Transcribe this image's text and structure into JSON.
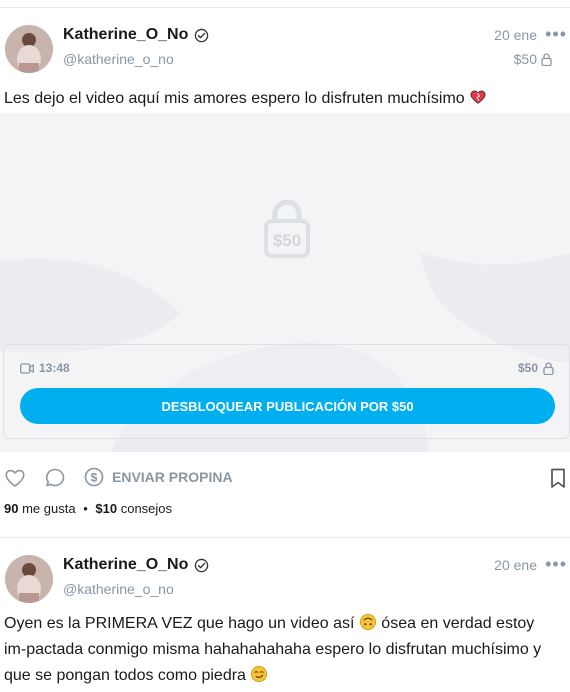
{
  "posts": [
    {
      "author": {
        "name": "Katherine_O_No",
        "handle": "@katherine_o_no"
      },
      "date": "20 ene",
      "price": "$50",
      "text": "Les dejo el video aquí mis amores espero lo disfruten muchísimo",
      "media": {
        "lock_price": "$50",
        "duration": "13:48",
        "panel_price": "$50",
        "unlock_label": "DESBLOQUEAR PUBLICACIÓN POR $50"
      },
      "tip_label": "ENVIAR PROPINA",
      "likes_count": "90",
      "likes_label": "me gusta",
      "tips_amount": "$10",
      "tips_label": "consejos"
    },
    {
      "author": {
        "name": "Katherine_O_No",
        "handle": "@katherine_o_no"
      },
      "date": "20 ene",
      "text_parts": [
        "Oyen es la PRIMERA VEZ que hago un video así ",
        " ósea en verdad estoy im-pactada conmigo misma hahahahahaha espero lo disfrutan muchísimo y que se pongan todos como piedra "
      ]
    }
  ],
  "colors": {
    "accent": "#00aff0",
    "muted": "#8a96a3",
    "media_bg": "#f3f4f6"
  }
}
